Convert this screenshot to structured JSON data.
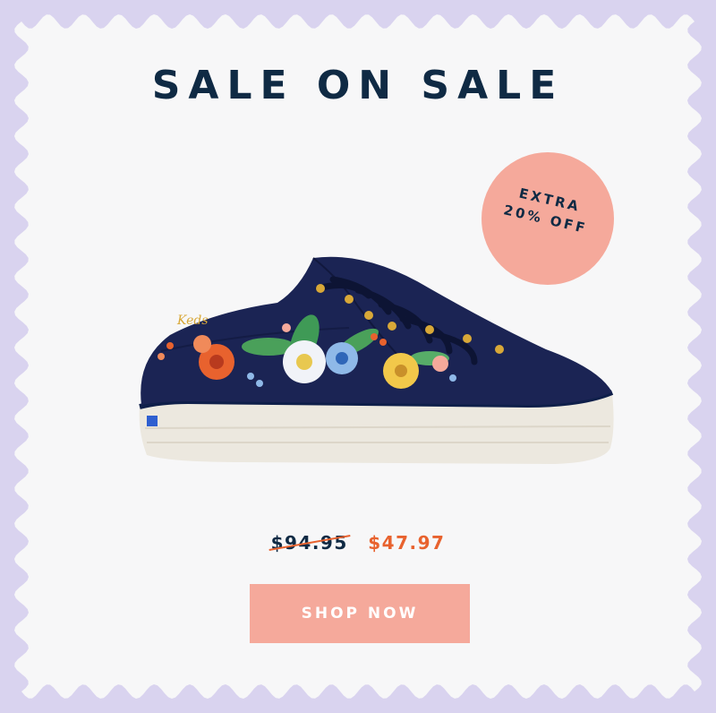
{
  "headline": "SALE ON SALE",
  "badge": {
    "line1": "EXTRA",
    "line2": "20% OFF",
    "color": "#f5a99b"
  },
  "product": {
    "image_label": "Keds",
    "icon": "embroidered-floral-sneaker"
  },
  "pricing": {
    "original_price": "$94.95",
    "sale_price": "$47.97",
    "sale_color": "#e8622e"
  },
  "cta": {
    "label": "SHOP NOW",
    "color": "#f5a99b"
  },
  "colors": {
    "frame": "#d9d3ef",
    "card": "#f7f7f8",
    "text": "#0f2a44"
  }
}
